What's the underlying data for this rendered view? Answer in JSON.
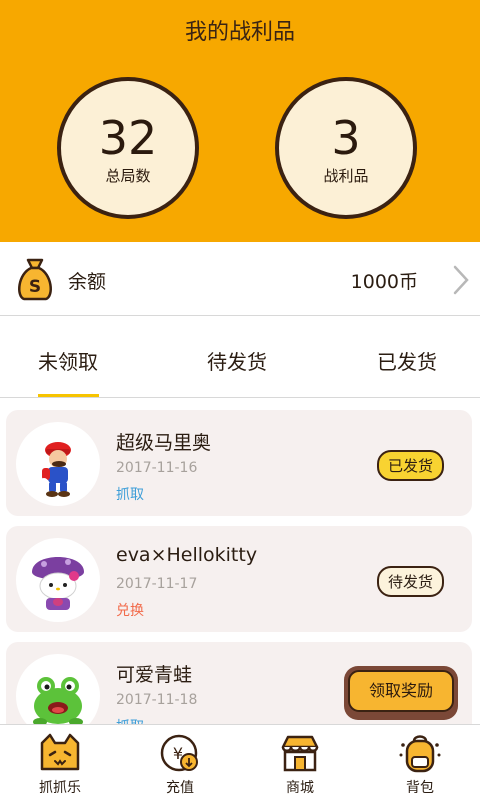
{
  "header": {
    "title": "我的战利品",
    "stats": [
      {
        "value": "32",
        "label": "总局数"
      },
      {
        "value": "3",
        "label": "战利品"
      }
    ]
  },
  "balance": {
    "label": "余额",
    "value": "1000币",
    "icon": "money-bag-icon"
  },
  "tabs": [
    {
      "label": "未领取",
      "active": true
    },
    {
      "label": "待发货",
      "active": false
    },
    {
      "label": "已发货",
      "active": false
    }
  ],
  "items": [
    {
      "name": "超级马里奥",
      "date": "2017-11-16",
      "type": "抓取",
      "status": "已发货",
      "image": "mario-figure"
    },
    {
      "name": "eva×Hellokitty",
      "date": "2017-11-17",
      "type": "兑换",
      "status": "待发货",
      "image": "hellokitty-figure"
    },
    {
      "name": "可爱青蛙",
      "date": "2017-11-18",
      "type": "抓取",
      "image": "frog-figure"
    }
  ],
  "claim_button": {
    "label": "领取奖励"
  },
  "bottom_nav": [
    {
      "label": "抓抓乐",
      "icon": "cat-icon"
    },
    {
      "label": "充值",
      "icon": "recharge-icon"
    },
    {
      "label": "商城",
      "icon": "shop-icon"
    },
    {
      "label": "背包",
      "icon": "backpack-icon"
    }
  ],
  "colors": {
    "header_bg": "#f7a800",
    "circle_fill": "#fcf0d6",
    "tab_underline": "#f7c400",
    "type_blue": "#3d9ed8",
    "type_red": "#f26a4a",
    "badge_yellow": "#f8d331",
    "claim_button": "#f7b530"
  }
}
